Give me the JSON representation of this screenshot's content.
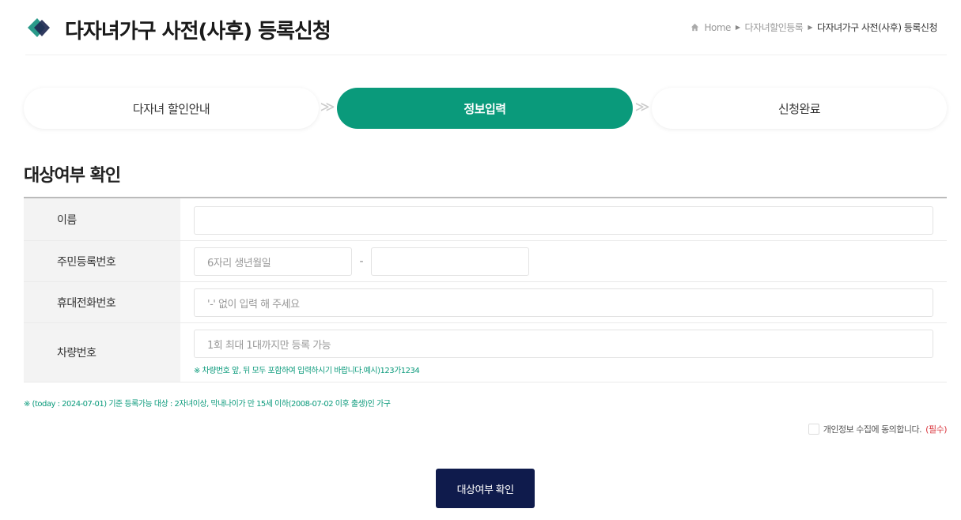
{
  "header": {
    "title": "다자녀가구 사전(사후) 등록신청",
    "breadcrumb": {
      "home": "Home",
      "parent": "다자녀할인등록",
      "current": "다자녀가구 사전(사후) 등록신청"
    }
  },
  "steps": [
    {
      "label": "다자녀 할인안내",
      "state": "inactive"
    },
    {
      "label": "정보입력",
      "state": "active"
    },
    {
      "label": "신청완료",
      "state": "inactive"
    }
  ],
  "section": {
    "title": "대상여부 확인"
  },
  "form": {
    "name": {
      "label": "이름",
      "placeholder": ""
    },
    "jumin": {
      "label": "주민등록번호",
      "front_placeholder": "6자리 생년월일",
      "dash": "-",
      "back_placeholder": ""
    },
    "phone": {
      "label": "휴대전화번호",
      "placeholder": "'-' 없이 입력 해 주세요"
    },
    "car": {
      "label": "차량번호",
      "placeholder": "1회 최대 1대까지만 등록 가능",
      "help": "※ 차량번호 앞, 뒤 모두 포함하여 입력하시기 바랍니다.예시)123가1234"
    }
  },
  "note": "※ (today : 2024-07-01) 기준 등록가능 대상 : 2자녀이상, 막내나이가 만 15세 이하(2008-07-02 이후 출생)인 가구",
  "agree": {
    "label": "개인정보 수집에 동의합니다.",
    "required": "(필수)"
  },
  "submit_label": "대상여부 확인",
  "colors": {
    "accent": "#0a9a7b",
    "button": "#0f1b4c",
    "required": "#d9363e"
  }
}
